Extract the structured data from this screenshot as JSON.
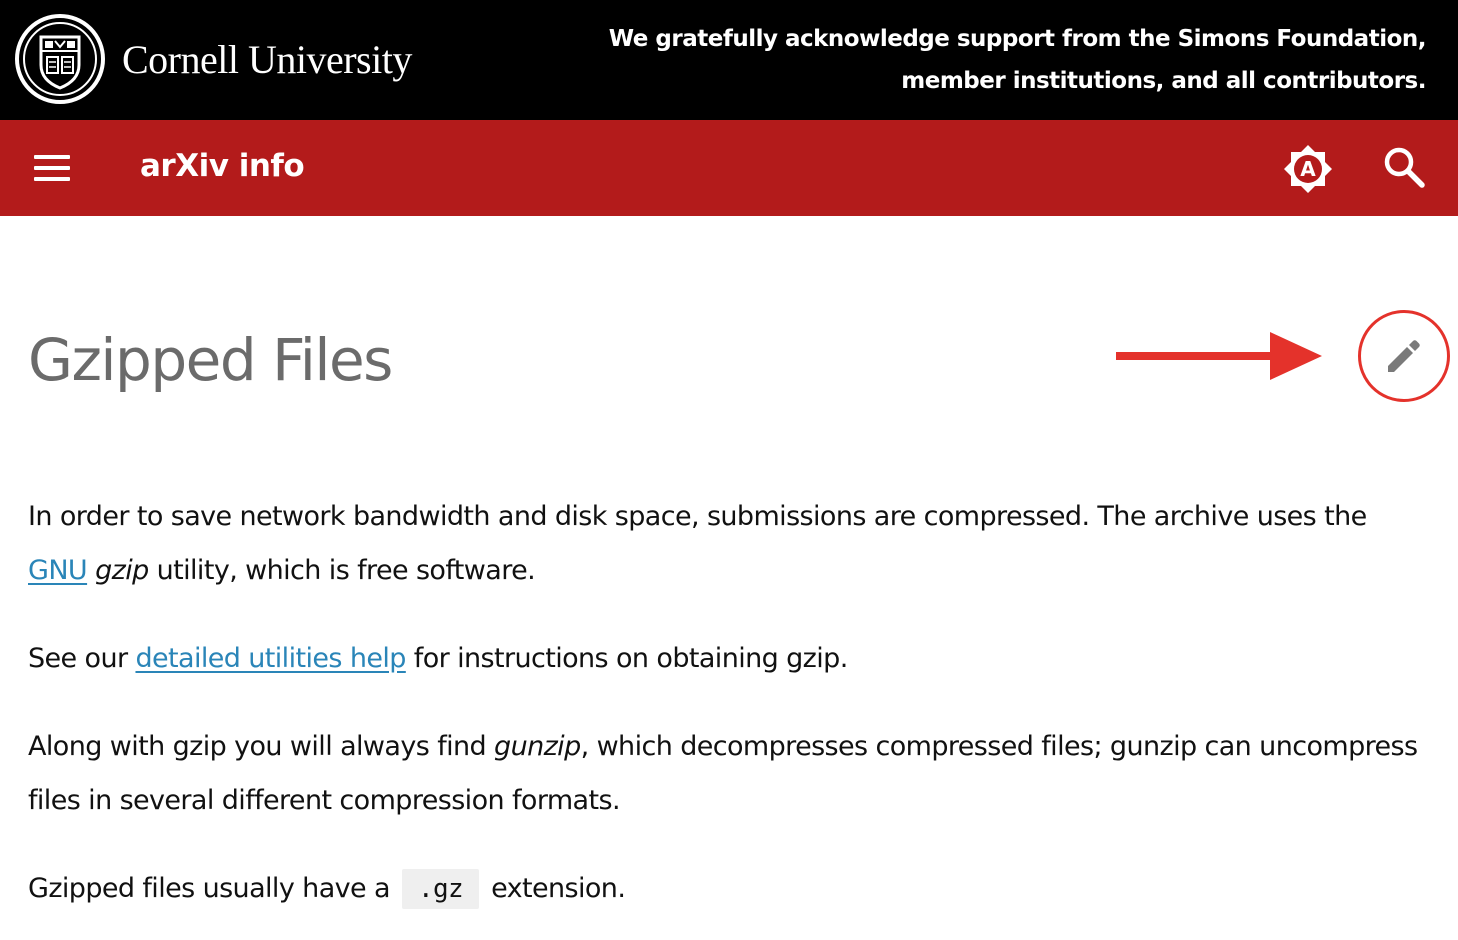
{
  "top_banner": {
    "institution_name": "Cornell University",
    "support_line_1": "We gratefully acknowledge support from the Simons Foundation,",
    "support_line_2": "member institutions, and all contributors."
  },
  "navbar": {
    "title": "arXiv info",
    "contrast_toggle_letter": "A",
    "icons": [
      "menu-icon",
      "contrast-toggle-icon",
      "search-icon"
    ]
  },
  "page": {
    "title": "Gzipped Files",
    "edit_icon": "pencil-icon"
  },
  "paragraphs": {
    "p1": {
      "text_1": "In order to save network bandwidth and disk space, submissions are compressed. The archive uses the ",
      "link_gnu": "GNU",
      "gzip_em": "gzip",
      "text_2": " utility, which is free software."
    },
    "p2": {
      "text_1": "See our ",
      "link_help": "detailed utilities help",
      "text_2": " for instructions on obtaining gzip."
    },
    "p3": {
      "text_1": "Along with gzip you will always find ",
      "gunzip_em": "gunzip",
      "text_2": ", which decompresses compressed files; gunzip can uncompress files in several different compression formats."
    },
    "p4": {
      "text_1": "Gzipped files usually have a",
      "code": ".gz",
      "text_2": "extension."
    }
  },
  "colors": {
    "banner_bg": "#000000",
    "nav_red": "#b31b1b",
    "title_gray": "#6b6b6b",
    "link_blue": "#2a85b8",
    "annotation_red": "#e4322b"
  }
}
